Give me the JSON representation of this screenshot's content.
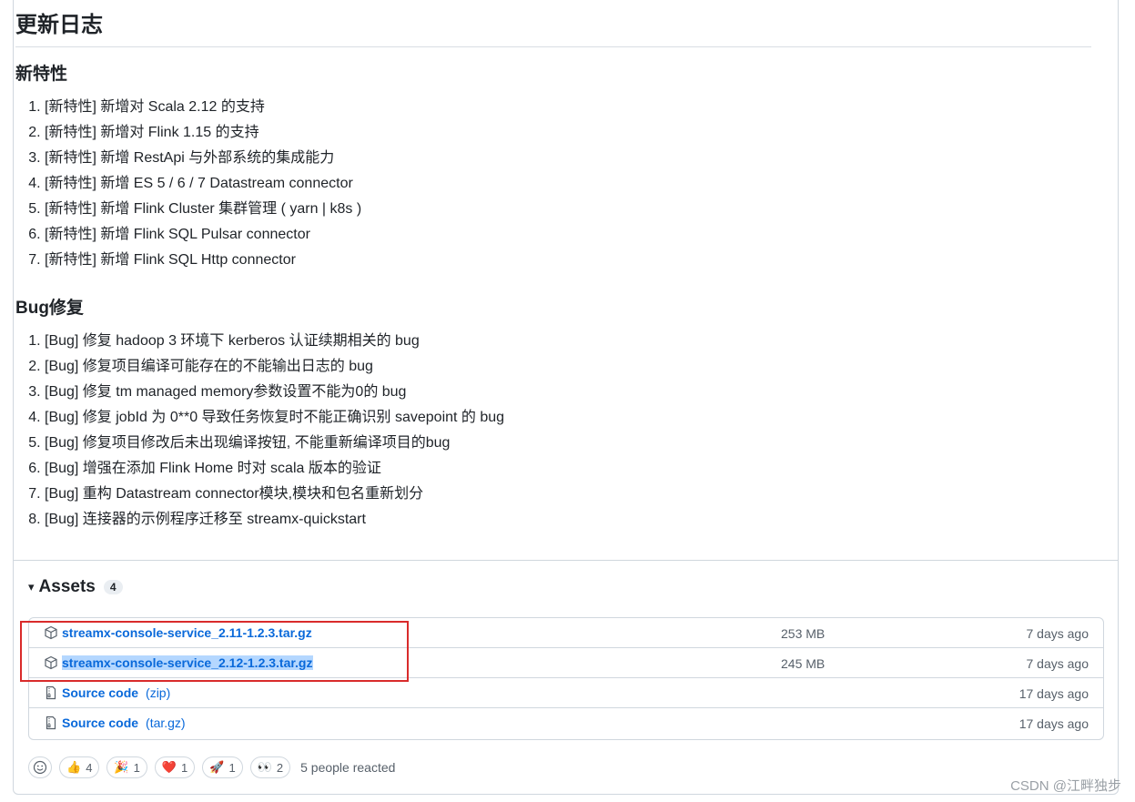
{
  "release": {
    "title": "更新日志",
    "features": {
      "heading": "新特性",
      "items": [
        "[新特性] 新增对 Scala 2.12 的支持",
        "[新特性] 新增对 Flink 1.15 的支持",
        "[新特性] 新增 RestApi 与外部系统的集成能力",
        "[新特性] 新增 ES 5 / 6 / 7 Datastream connector",
        "[新特性] 新增 Flink Cluster 集群管理 ( yarn | k8s )",
        "[新特性] 新增 Flink SQL Pulsar connector",
        "[新特性] 新增 Flink SQL Http connector"
      ]
    },
    "bugs": {
      "heading": "Bug修复",
      "items": [
        "[Bug] 修复 hadoop 3 环境下 kerberos 认证续期相关的 bug",
        "[Bug] 修复项目编译可能存在的不能输出日志的 bug",
        "[Bug] 修复 tm managed memory参数设置不能为0的 bug",
        "[Bug] 修复 jobId 为 0**0 导致任务恢复时不能正确识别 savepoint 的 bug",
        "[Bug] 修复项目修改后未出现编译按钮, 不能重新编译项目的bug",
        "[Bug] 增强在添加 Flink Home 时对 scala 版本的验证",
        "[Bug] 重构 Datastream connector模块,模块和包名重新划分",
        "[Bug] 连接器的示例程序迁移至 streamx-quickstart"
      ]
    }
  },
  "assets": {
    "caret": "▾",
    "title": "Assets",
    "count": "4",
    "rows": [
      {
        "icon": "package-icon",
        "name": "streamx-console-service_2.11-1.2.3.tar.gz",
        "suffix": "",
        "size": "253 MB",
        "date": "7 days ago"
      },
      {
        "icon": "package-icon",
        "name": "streamx-console-service_2.12-1.2.3.tar.gz",
        "suffix": "",
        "size": "245 MB",
        "date": "7 days ago"
      },
      {
        "icon": "file-zip-icon",
        "name": "Source code",
        "suffix": "(zip)",
        "size": "",
        "date": "17 days ago"
      },
      {
        "icon": "file-zip-icon",
        "name": "Source code",
        "suffix": "(tar.gz)",
        "size": "",
        "date": "17 days ago"
      }
    ]
  },
  "reactions": {
    "items": [
      {
        "emoji": "👍",
        "count": "4"
      },
      {
        "emoji": "🎉",
        "count": "1"
      },
      {
        "emoji": "❤️",
        "count": "1"
      },
      {
        "emoji": "🚀",
        "count": "1"
      },
      {
        "emoji": "👀",
        "count": "2"
      }
    ],
    "summary": "5 people reacted"
  },
  "watermark": "CSDN @江畔独步",
  "colors": {
    "link": "#0969da",
    "highlight_border": "#d92b2b",
    "selection": "#b4d7ff"
  }
}
